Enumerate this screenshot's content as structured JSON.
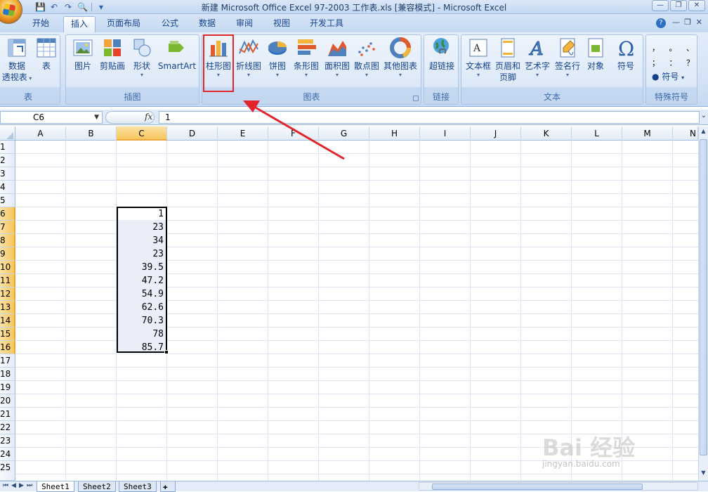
{
  "window": {
    "title": "新建 Microsoft Office Excel 97-2003 工作表.xls  [兼容模式] - Microsoft Excel",
    "buttons": {
      "minimize": "—",
      "restore": "❐",
      "close": "✕"
    }
  },
  "tabs": [
    "开始",
    "插入",
    "页面布局",
    "公式",
    "数据",
    "审阅",
    "视图",
    "开发工具"
  ],
  "active_tab": "插入",
  "ribbon": {
    "groups": {
      "tables": {
        "label": "表",
        "buttons": [
          {
            "label": "数据",
            "label2": "透视表",
            "icon": "pivot-table-icon"
          },
          {
            "label": "表",
            "icon": "table-icon"
          }
        ]
      },
      "illustrations": {
        "label": "插图",
        "buttons": [
          {
            "label": "图片",
            "icon": "picture-icon"
          },
          {
            "label": "剪贴画",
            "icon": "clipart-icon"
          },
          {
            "label": "形状",
            "icon": "shapes-icon"
          },
          {
            "label": "SmartArt",
            "icon": "smartart-icon"
          }
        ]
      },
      "charts": {
        "label": "图表",
        "buttons": [
          {
            "label": "柱形图",
            "icon": "column-chart-icon"
          },
          {
            "label": "折线图",
            "icon": "line-chart-icon"
          },
          {
            "label": "饼图",
            "icon": "pie-chart-icon"
          },
          {
            "label": "条形图",
            "icon": "bar-chart-icon"
          },
          {
            "label": "面积图",
            "icon": "area-chart-icon"
          },
          {
            "label": "散点图",
            "icon": "scatter-chart-icon"
          },
          {
            "label": "其他图表",
            "icon": "other-charts-icon"
          }
        ]
      },
      "links": {
        "label": "链接",
        "buttons": [
          {
            "label": "超链接",
            "icon": "hyperlink-icon"
          }
        ]
      },
      "text": {
        "label": "文本",
        "buttons": [
          {
            "label": "文本框",
            "icon": "textbox-icon"
          },
          {
            "label": "页眉和",
            "label2": "页脚",
            "icon": "header-footer-icon"
          },
          {
            "label": "艺术字",
            "icon": "wordart-icon"
          },
          {
            "label": "签名行",
            "icon": "signature-icon"
          },
          {
            "label": "对象",
            "icon": "object-icon"
          },
          {
            "label": "符号",
            "icon": "omega-icon"
          }
        ]
      },
      "special_symbols": {
        "label": "特殊符号",
        "symbols_row1": [
          "，",
          "。",
          "、"
        ],
        "symbols_row2": [
          "；",
          "：",
          "？"
        ],
        "button": "符号"
      }
    }
  },
  "formula_bar": {
    "name_box": "C6",
    "fx": "fx",
    "value": "1"
  },
  "grid": {
    "columns": [
      "A",
      "B",
      "C",
      "D",
      "E",
      "F",
      "G",
      "H",
      "I",
      "J",
      "K",
      "L",
      "M",
      "N"
    ],
    "selected_column": "C",
    "rows": [
      "1",
      "2",
      "3",
      "4",
      "5",
      "6",
      "7",
      "8",
      "9",
      "10",
      "11",
      "12",
      "13",
      "14",
      "15",
      "16",
      "17",
      "18",
      "19",
      "20",
      "21",
      "22",
      "23",
      "24",
      "25"
    ],
    "selected_rows": [
      "6",
      "7",
      "8",
      "9",
      "10",
      "11",
      "12",
      "13",
      "14",
      "15",
      "16"
    ],
    "values_c6_to_c16": [
      "1",
      "23",
      "34",
      "23",
      "39.5",
      "47.2",
      "54.9",
      "62.6",
      "70.3",
      "78",
      "85.7"
    ]
  },
  "sheets": [
    "Sheet1",
    "Sheet2",
    "Sheet3"
  ],
  "active_sheet": "Sheet1",
  "watermark": {
    "brand": "Bai 经验",
    "url": "jingyan.baidu.com"
  },
  "colors": {
    "highlight_box": "#e0262b",
    "arrow": "#e0262b",
    "selection_header": "#f7c65d"
  }
}
